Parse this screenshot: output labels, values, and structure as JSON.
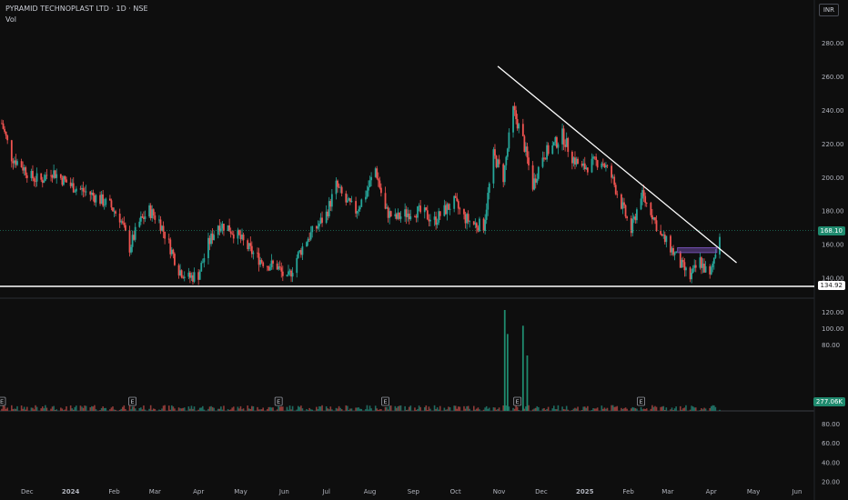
{
  "header": {
    "title": "PYRAMID TECHNOPLAST LTD · 1D · NSE",
    "volume_label": "Vol",
    "currency": "INR"
  },
  "tags": {
    "last_price": "168.10",
    "support_price": "134.92",
    "last_volume": "277.06K"
  },
  "colors": {
    "background": "#0e0e0e",
    "up": "#26a69a",
    "down": "#ef5350",
    "trendline": "#ffffff",
    "consolidation_box": "#7e57c2"
  },
  "chart_data": [
    {
      "type": "candlestick",
      "title": "PYRAMID TECHNOPLAST LTD · 1D · NSE",
      "currency": "INR",
      "ylim": [
        131,
        290
      ],
      "y_ticks": [
        "140.00",
        "160.00",
        "180.00",
        "200.00",
        "220.00",
        "240.00",
        "260.00",
        "280.00"
      ],
      "x_ticks": [
        "Dec",
        "2024",
        "Feb",
        "Mar",
        "Apr",
        "May",
        "Jun",
        "Jul",
        "Aug",
        "Sep",
        "Oct",
        "Nov",
        "Dec",
        "2025",
        "Feb",
        "Mar",
        "Apr",
        "May",
        "Jun"
      ],
      "x_range": [
        "2023-11-13",
        "2025-06-15"
      ],
      "daily_closes": [
        {
          "date": "2023-11-13",
          "close": 232
        },
        {
          "date": "2023-11-20",
          "close": 212
        },
        {
          "date": "2023-11-27",
          "close": 207
        },
        {
          "date": "2023-12-04",
          "close": 200
        },
        {
          "date": "2023-12-11",
          "close": 198
        },
        {
          "date": "2023-12-18",
          "close": 204
        },
        {
          "date": "2024-01-01",
          "close": 195
        },
        {
          "date": "2024-01-15",
          "close": 190
        },
        {
          "date": "2024-01-29",
          "close": 183
        },
        {
          "date": "2024-02-05",
          "close": 176
        },
        {
          "date": "2024-02-12",
          "close": 158
        },
        {
          "date": "2024-02-19",
          "close": 173
        },
        {
          "date": "2024-02-26",
          "close": 180
        },
        {
          "date": "2024-03-04",
          "close": 174
        },
        {
          "date": "2024-03-11",
          "close": 160
        },
        {
          "date": "2024-03-18",
          "close": 145
        },
        {
          "date": "2024-03-25",
          "close": 140
        },
        {
          "date": "2024-04-01",
          "close": 142
        },
        {
          "date": "2024-04-08",
          "close": 160
        },
        {
          "date": "2024-04-15",
          "close": 172
        },
        {
          "date": "2024-04-22",
          "close": 170
        },
        {
          "date": "2024-04-29",
          "close": 165
        },
        {
          "date": "2024-05-06",
          "close": 158
        },
        {
          "date": "2024-05-13",
          "close": 152
        },
        {
          "date": "2024-05-20",
          "close": 148
        },
        {
          "date": "2024-05-27",
          "close": 147
        },
        {
          "date": "2024-06-03",
          "close": 138
        },
        {
          "date": "2024-06-10",
          "close": 152
        },
        {
          "date": "2024-06-17",
          "close": 163
        },
        {
          "date": "2024-06-24",
          "close": 170
        },
        {
          "date": "2024-07-01",
          "close": 178
        },
        {
          "date": "2024-07-08",
          "close": 195
        },
        {
          "date": "2024-07-15",
          "close": 185
        },
        {
          "date": "2024-07-22",
          "close": 180
        },
        {
          "date": "2024-07-29",
          "close": 190
        },
        {
          "date": "2024-08-05",
          "close": 205
        },
        {
          "date": "2024-08-12",
          "close": 180
        },
        {
          "date": "2024-08-19",
          "close": 175
        },
        {
          "date": "2024-08-26",
          "close": 178
        },
        {
          "date": "2024-09-02",
          "close": 180
        },
        {
          "date": "2024-09-09",
          "close": 178
        },
        {
          "date": "2024-09-16",
          "close": 174
        },
        {
          "date": "2024-09-23",
          "close": 180
        },
        {
          "date": "2024-09-30",
          "close": 185
        },
        {
          "date": "2024-10-07",
          "close": 176
        },
        {
          "date": "2024-10-14",
          "close": 172
        },
        {
          "date": "2024-10-21",
          "close": 171
        },
        {
          "date": "2024-10-28",
          "close": 213
        },
        {
          "date": "2024-11-04",
          "close": 200
        },
        {
          "date": "2024-11-11",
          "close": 240
        },
        {
          "date": "2024-11-18",
          "close": 222
        },
        {
          "date": "2024-11-25",
          "close": 195
        },
        {
          "date": "2024-12-02",
          "close": 213
        },
        {
          "date": "2024-12-09",
          "close": 218
        },
        {
          "date": "2024-12-16",
          "close": 225
        },
        {
          "date": "2024-12-23",
          "close": 212
        },
        {
          "date": "2024-12-30",
          "close": 205
        },
        {
          "date": "2025-01-06",
          "close": 208
        },
        {
          "date": "2025-01-13",
          "close": 210
        },
        {
          "date": "2025-01-20",
          "close": 200
        },
        {
          "date": "2025-01-27",
          "close": 184
        },
        {
          "date": "2025-02-03",
          "close": 168
        },
        {
          "date": "2025-02-10",
          "close": 190
        },
        {
          "date": "2025-02-17",
          "close": 180
        },
        {
          "date": "2025-02-24",
          "close": 165
        },
        {
          "date": "2025-03-03",
          "close": 158
        },
        {
          "date": "2025-03-10",
          "close": 148
        },
        {
          "date": "2025-03-17",
          "close": 140
        },
        {
          "date": "2025-03-24",
          "close": 150
        },
        {
          "date": "2025-03-31",
          "close": 140
        },
        {
          "date": "2025-04-07",
          "close": 168.1
        }
      ],
      "last_price": 168.1,
      "support_line": 134.92,
      "trendline": {
        "from": {
          "date": "2024-10-31",
          "price": 266
        },
        "to": {
          "date": "2025-04-19",
          "price": 149
        }
      },
      "consolidation_box": {
        "from": "2025-03-08",
        "to": "2025-04-05",
        "low": 155,
        "high": 158
      },
      "earnings_markers": [
        "E",
        "E",
        "E",
        "E",
        "E",
        "E"
      ]
    },
    {
      "type": "bar",
      "title": "Vol",
      "ylim": [
        0,
        130
      ],
      "y_ticks": [
        "80.00",
        "100.00",
        "120.00"
      ],
      "last_value": "277.06K",
      "spikes": [
        {
          "date": "2024-11-05",
          "value": 122
        },
        {
          "date": "2024-11-07",
          "value": 93
        },
        {
          "date": "2024-11-18",
          "value": 103
        },
        {
          "date": "2024-11-21",
          "value": 67
        }
      ]
    },
    {
      "type": "line",
      "title": "",
      "ylim": [
        16,
        100
      ],
      "y_ticks": [
        "80.00",
        "60.00",
        "40.00",
        "20.00"
      ]
    }
  ]
}
